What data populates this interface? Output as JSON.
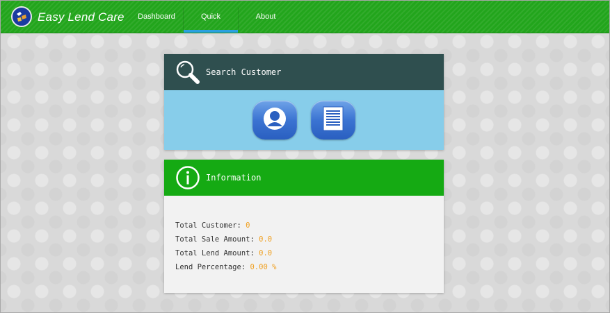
{
  "app": {
    "brand": "Easy Lend Care",
    "logo_icon": "app-logo-icon"
  },
  "nav": {
    "items": [
      {
        "label": "Dashboard",
        "active": false
      },
      {
        "label": "Quick",
        "active": true
      },
      {
        "label": "About",
        "active": false
      }
    ]
  },
  "search_card": {
    "title": "Search Customer",
    "icon": "magnifier-icon",
    "buttons": [
      {
        "icon": "customer-icon"
      },
      {
        "icon": "document-list-icon"
      }
    ]
  },
  "info_card": {
    "title": "Information",
    "icon": "info-icon",
    "stats": [
      {
        "label": "Total Customer:",
        "value": "0"
      },
      {
        "label": "Total Sale Amount:",
        "value": "0.0"
      },
      {
        "label": "Total Lend Amount:",
        "value": "0.0"
      },
      {
        "label": "Lend Percentage:",
        "value": "0.00 %"
      }
    ]
  },
  "colors": {
    "topbar": "#22a51c",
    "nav_active_underline": "#2aa0e0",
    "search_header": "#2f4f4f",
    "search_body": "#87cdea",
    "info_header": "#15aa13",
    "stat_value": "#f0a020"
  }
}
